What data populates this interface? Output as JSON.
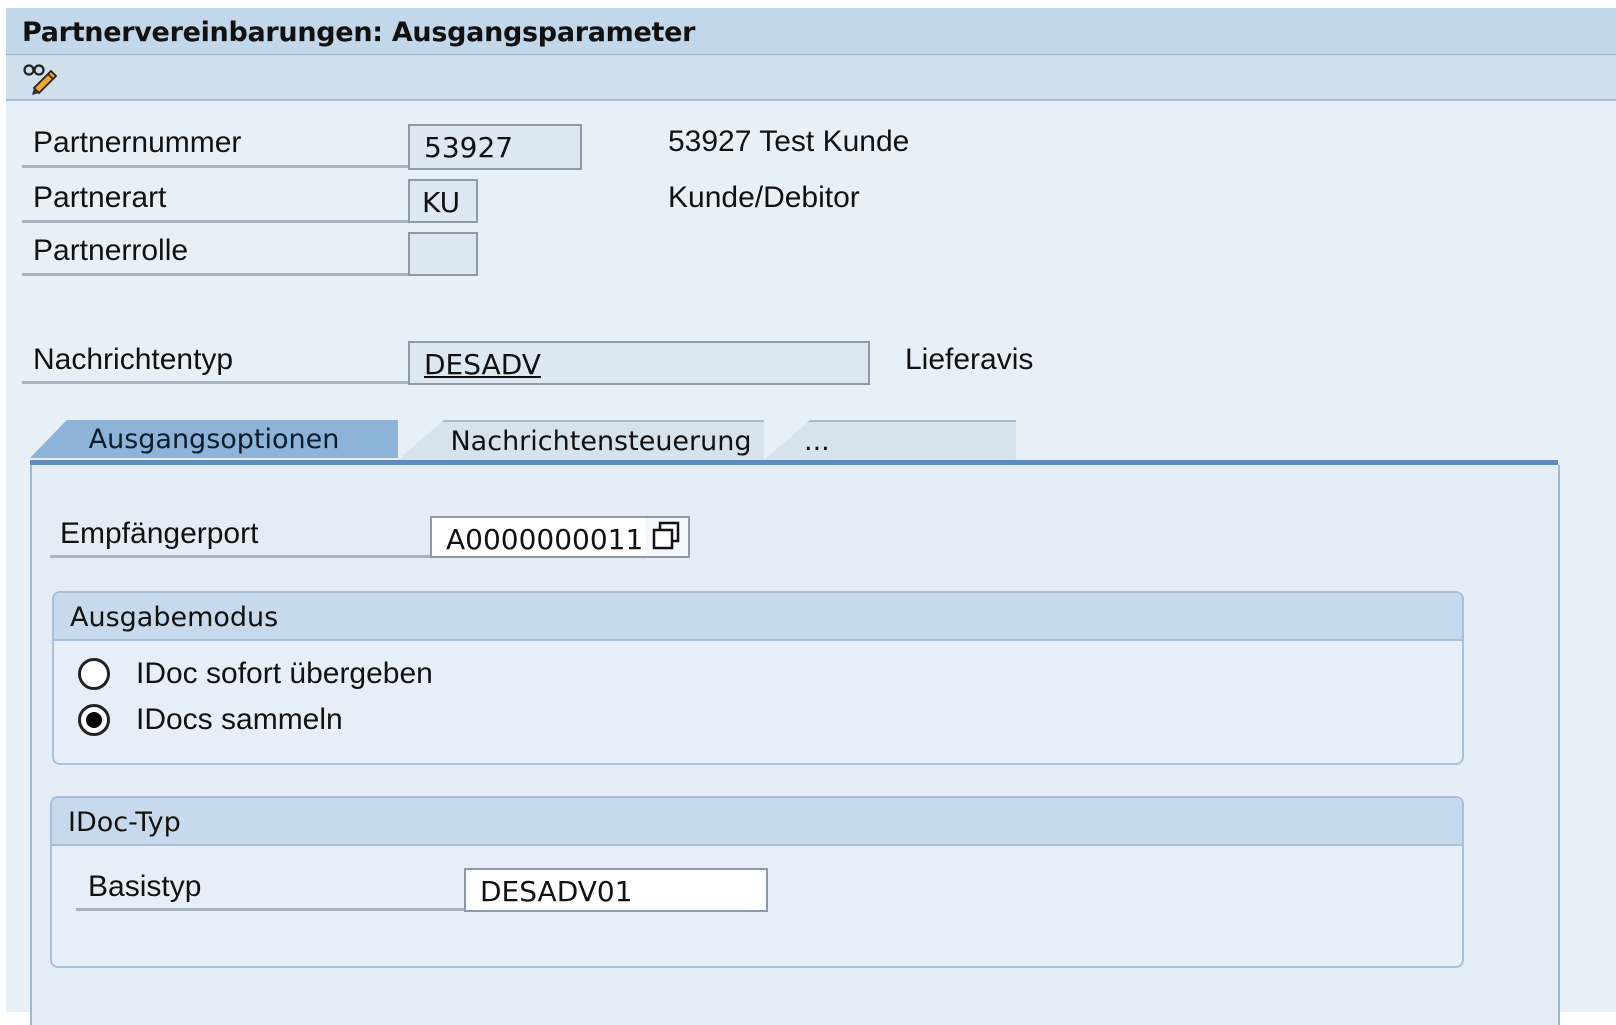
{
  "window": {
    "title": "Partnervereinbarungen: Ausgangsparameter"
  },
  "toolbar": {
    "edit_icon": "glasses-pencil-icon"
  },
  "header": {
    "partnernummer_label": "Partnernummer",
    "partnernummer_value": "53927",
    "partnernummer_desc": "53927  Test Kunde",
    "partnerart_label": "Partnerart",
    "partnerart_value": "KU",
    "partnerart_desc": "Kunde/Debitor",
    "partnerrolle_label": "Partnerrolle",
    "partnerrolle_value": "",
    "nachrichtentyp_label": "Nachrichtentyp",
    "nachrichtentyp_value": "DESADV",
    "nachrichtentyp_desc": "Lieferavis"
  },
  "tabs": [
    {
      "label": "Ausgangsoptionen",
      "active": true
    },
    {
      "label": "Nachrichtensteuerung",
      "active": false
    },
    {
      "label": "...",
      "active": false
    }
  ],
  "ausgangsoptionen": {
    "empfaengerport_label": "Empfängerport",
    "empfaengerport_value": "A0000000011",
    "valuehelp_icon": "copy-windows-icon",
    "ausgabemodus": {
      "title": "Ausgabemodus",
      "options": [
        {
          "label": "IDoc sofort übergeben",
          "selected": false
        },
        {
          "label": "IDocs sammeln",
          "selected": true
        }
      ]
    },
    "idoc_typ": {
      "title": "IDoc-Typ",
      "basistyp_label": "Basistyp",
      "basistyp_value": "DESADV01"
    }
  },
  "colors": {
    "title_bg": "#c3d7ea",
    "active_tab": "#8eb3d9",
    "tab_underline": "#5f8cbd",
    "window_bg": "#e8f0f7"
  }
}
